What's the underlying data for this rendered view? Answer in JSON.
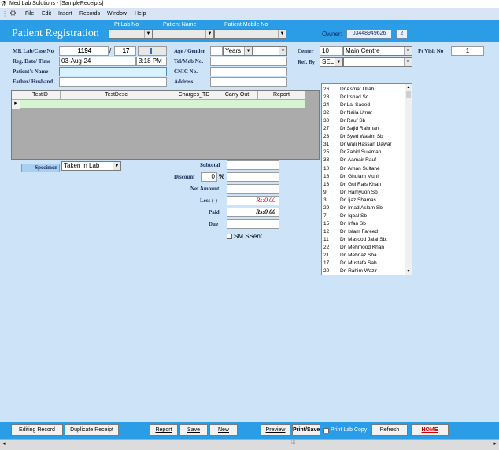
{
  "window": {
    "title": "Med Lab Solutions - [SampleReceipts]"
  },
  "menu": {
    "items": [
      "File",
      "Edit",
      "Insert",
      "Records",
      "Window",
      "Help"
    ]
  },
  "header": {
    "title": "Patient Registration",
    "pt_lab_no_label": "Pt Lab No",
    "patient_name_label": "Patient Name",
    "patient_mobile_label": "Patient Mobile No",
    "owner_label": "Owner:",
    "owner_value": "03448949626",
    "owner_badge": "2"
  },
  "form": {
    "mr_label": "MR Lab/Case No",
    "mr_value": "1194",
    "slash": "/",
    "case_value": "17",
    "reg_label": "Reg. Date/ Time",
    "reg_date": "03-Aug-24",
    "reg_time": "3:18 PM",
    "patient_name_label": "Patient's Name",
    "father_label": "Father/ Husband",
    "age_label": "Age / Gender",
    "age_unit": "Years",
    "tel_label": "Tel/Mob No.",
    "cnic_label": "CNIC No.",
    "address_label": "Address",
    "center_label": "Center",
    "center_code": "10",
    "center_name": "Main Centre",
    "ref_label": "Ref. By",
    "ref_value": "SEL",
    "pt_visit_label": "Pt Visit No",
    "pt_visit_value": "1"
  },
  "grid": {
    "columns": [
      "TestID",
      "TestDesc",
      "Charges_TD",
      "Carry Out",
      "Report"
    ],
    "row_marker": "▸"
  },
  "specimen": {
    "label": "Specimen",
    "value": "Taken in Lab"
  },
  "totals": {
    "subtotal_label": "Subtotal",
    "discount_label": "Discount",
    "discount_value": "0",
    "percent": "%",
    "net_label": "Net Amount",
    "less_label": "Less (-)",
    "less_value": "Rs:0.00",
    "paid_label": "Paid",
    "paid_value": "Rs:0.00",
    "due_label": "Due",
    "sms_label": "SM SSent"
  },
  "doctors": [
    {
      "id": "26",
      "name": "Dr Asmat Ullah"
    },
    {
      "id": "28",
      "name": "Dr Irshad Sc"
    },
    {
      "id": "24",
      "name": "Dr Lal Saeed"
    },
    {
      "id": "32",
      "name": "Dr Naila Umar"
    },
    {
      "id": "30",
      "name": "Dr Rauf Sb"
    },
    {
      "id": "27",
      "name": "Dr Sajid Rahman"
    },
    {
      "id": "23",
      "name": "Dr Syed Wasim Sb"
    },
    {
      "id": "31",
      "name": "Dr Wali Hassan Dawar"
    },
    {
      "id": "25",
      "name": "Dr Zahid Suleman"
    },
    {
      "id": "33",
      "name": "Dr. Aamair Rauf"
    },
    {
      "id": "10",
      "name": "Dr. Aman Sultane"
    },
    {
      "id": "16",
      "name": "Dr. Ghulam Munir"
    },
    {
      "id": "13",
      "name": "Dr. Gul Rais Khan"
    },
    {
      "id": "9",
      "name": "Dr. Hamyuon Sb"
    },
    {
      "id": "3",
      "name": "Dr. Ijaz Shamas"
    },
    {
      "id": "29",
      "name": "Dr. Imad Aslam Sb"
    },
    {
      "id": "7",
      "name": "Dr. Iqbal Sb"
    },
    {
      "id": "15",
      "name": "Dr. Irfan Sb"
    },
    {
      "id": "12",
      "name": "Dr. Islam Fareed"
    },
    {
      "id": "11",
      "name": "Dr. Masood Jalal Sb."
    },
    {
      "id": "22",
      "name": "Dr. Mehmood Khan"
    },
    {
      "id": "21",
      "name": "Dr. Mehnaz Sba"
    },
    {
      "id": "17",
      "name": "Dr. Mustafa Sab"
    },
    {
      "id": "20",
      "name": "Dr. Rahim Wazir"
    }
  ],
  "buttons": {
    "editing_record": "Editing Record",
    "duplicate_receipt": "Duplicate Receipt",
    "report": "Report",
    "save": "Save",
    "new": "New",
    "preview": "Preview",
    "print_save": "Print/Save",
    "print_lab_copy": "Print Lab Copy",
    "refresh": "Refresh",
    "home": "HOME"
  },
  "colors": {
    "header_blue": "#2a9de6",
    "form_bg": "#cde3f7",
    "home_red": "#cc0000",
    "amount_red": "#b00000"
  }
}
